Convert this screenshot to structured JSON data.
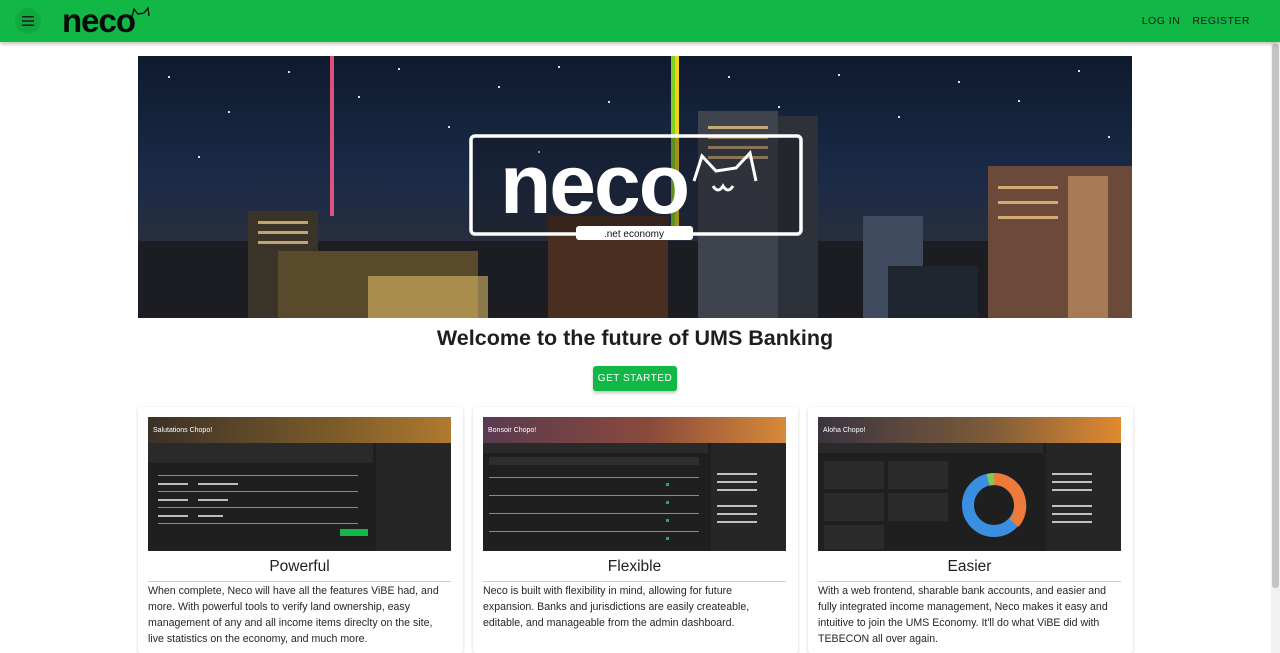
{
  "appbar": {
    "logo_text": "neco",
    "nav": [
      "LOG IN",
      "REGISTER"
    ],
    "color": "#12b846"
  },
  "hero": {
    "logo_text": "neco",
    "logo_sub": ".net economy"
  },
  "welcome": "Welcome to the future of UMS Banking",
  "cta_label": "GET STARTED",
  "cards": [
    {
      "title": "Powerful",
      "shot_greeting": "Salutations Chopo!",
      "description": "When complete, Neco will have all the features ViBE had, and more. With powerful tools to verify land ownership, easy management of any and all income items direclty on the site, live statistics on the economy, and much more."
    },
    {
      "title": "Flexible",
      "shot_greeting": "Bonsoir Chopo!",
      "description": "Neco is built with flexibility in mind, allowing for future expansion. Banks and jurisdictions are easily createable, editable, and manageable from the admin dashboard."
    },
    {
      "title": "Easier",
      "shot_greeting": "Aloha Chopo!",
      "description": "With a web frontend, sharable bank accounts, and easier and fully integrated income management, Neco makes it easy and intuitive to join the UMS Economy. It'll do what ViBE did with TEBECON all over again."
    }
  ],
  "icons": [
    "menu-icon",
    "cat-logo-icon"
  ]
}
